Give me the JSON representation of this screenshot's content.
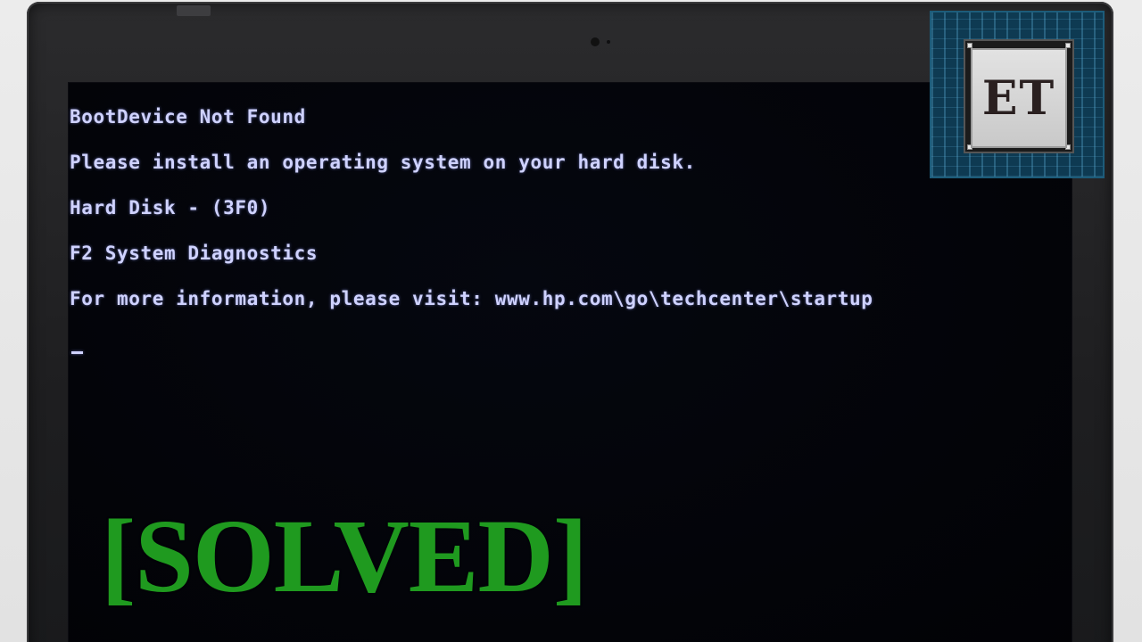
{
  "bios_screen": {
    "lines": [
      "BootDevice Not Found",
      "Please install an operating system on your hard disk.",
      "Hard Disk - (3F0)",
      "F2 System Diagnostics",
      "For more information, please visit: www.hp.com\\go\\techcenter\\startup"
    ],
    "cursor": "_"
  },
  "logo": {
    "text": "ET"
  },
  "overlay": {
    "solved_label": "[SOLVED]"
  },
  "colors": {
    "bios_text": "#cfd2ff",
    "solved_green": "#1f9a1f",
    "logo_blue": "#0e3a52"
  }
}
